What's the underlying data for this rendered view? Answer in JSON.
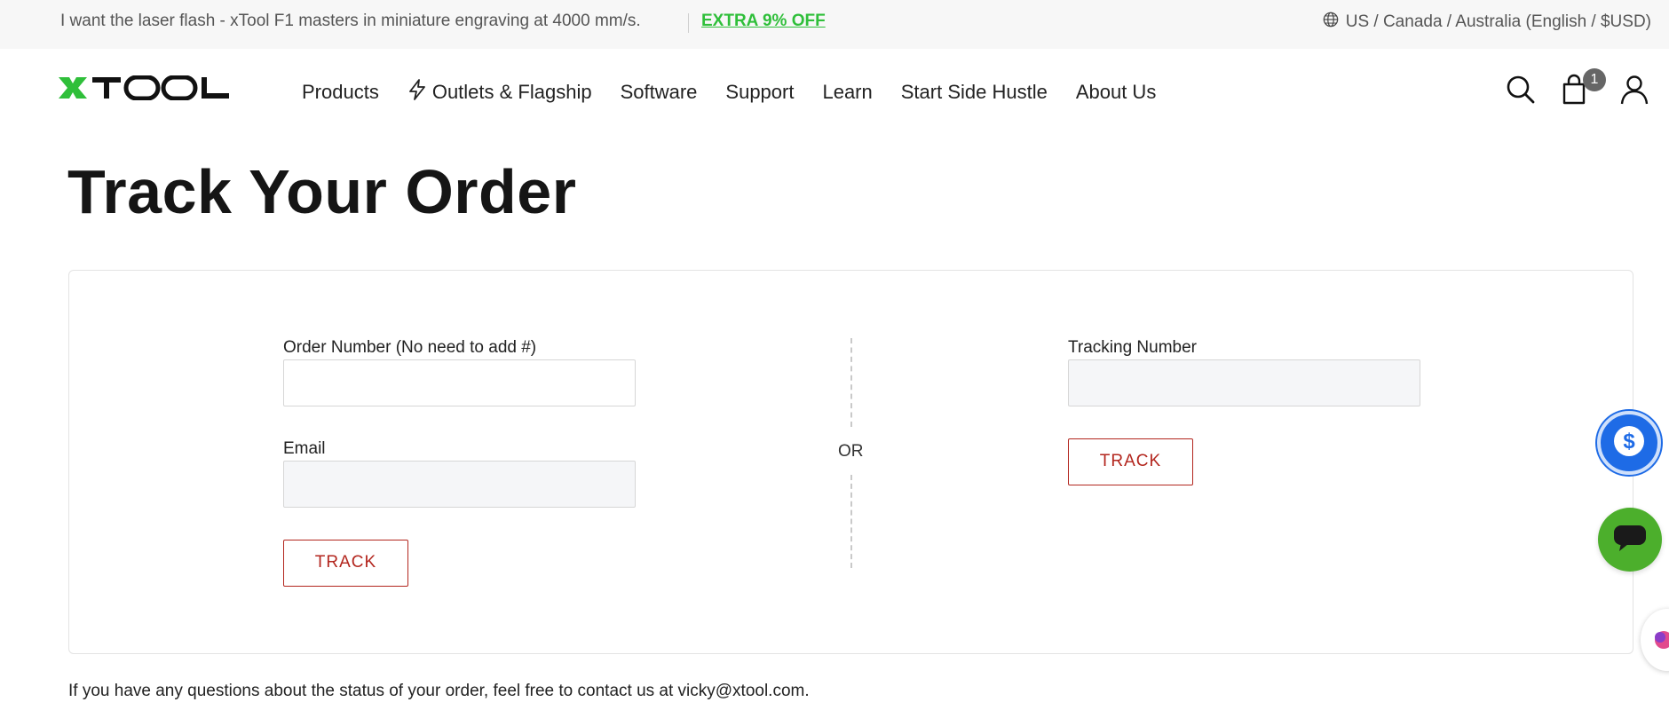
{
  "announcement": {
    "message": "I want the laser flash - xTool F1 masters in miniature engraving at 4000 mm/s.",
    "promo_link": "EXTRA 9% OFF",
    "locale": "US / Canada / Australia (English / $USD)"
  },
  "header": {
    "logo_alt": "XTOOL",
    "nav": [
      "Products",
      "Outlets & Flagship",
      "Software",
      "Support",
      "Learn",
      "Start Side Hustle",
      "About Us"
    ],
    "cart_count": "1"
  },
  "page": {
    "title": "Track Your Order"
  },
  "form_order": {
    "order_label": "Order Number (No need to add #)",
    "order_value": "",
    "email_label": "Email",
    "email_value": "",
    "track_label": "TRACK"
  },
  "divider": {
    "or_text": "OR"
  },
  "form_tracking": {
    "tracking_label": "Tracking Number",
    "tracking_value": "",
    "track_label": "TRACK"
  },
  "footer": {
    "help_text": "If you have any questions about the status of your order, feel free to contact us at vicky@xtool.com."
  },
  "colors": {
    "brand_green": "#2fbf3a",
    "track_red": "#b3261e",
    "fab_blue": "#1e6be6",
    "chat_green": "#4caf2c"
  },
  "icons": [
    "globe-icon",
    "lightning-icon",
    "search-icon",
    "cart-icon",
    "user-icon",
    "dollar-icon",
    "chat-icon"
  ]
}
